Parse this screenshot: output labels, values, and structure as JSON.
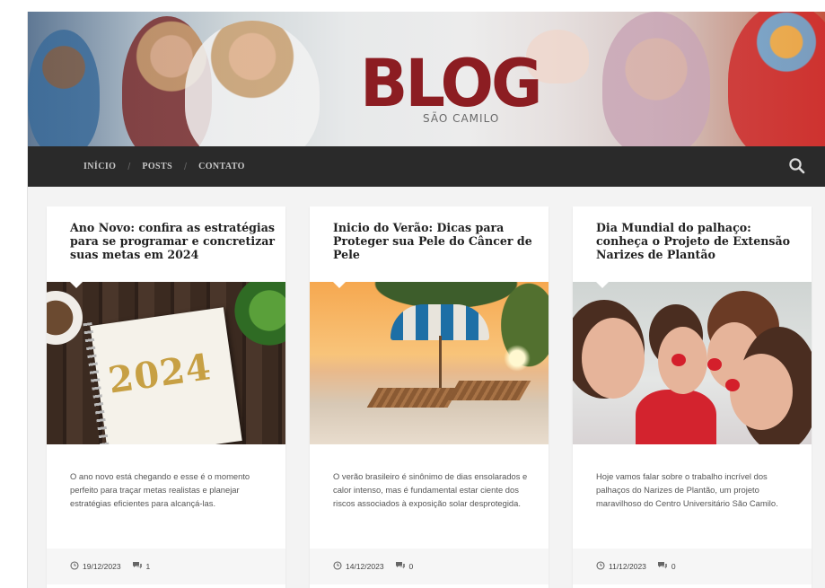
{
  "header": {
    "logo_main": "BLOG",
    "logo_sub": "SÃO CAMILO",
    "colors": {
      "logo": "#8c1d22",
      "nav_bg": "#2a2a2a"
    }
  },
  "nav": {
    "items": [
      {
        "label": "INÍCIO"
      },
      {
        "label": "POSTS"
      },
      {
        "label": "CONTATO"
      }
    ],
    "separator": "/",
    "search_icon": "search-icon"
  },
  "posts": [
    {
      "title": "Ano Novo: confira as estratégias para se programar e concretizar suas metas em 2024",
      "image_text": "2024",
      "excerpt": "O ano novo está chegando e esse é o momento perfeito para traçar metas realistas e planejar estratégias eficientes para alcançá-las.",
      "date": "19/12/2023",
      "comments": "1"
    },
    {
      "title": "Inicio do Verão: Dicas para Proteger sua Pele do Câncer de Pele",
      "excerpt": "O verão brasileiro é sinônimo de dias ensolarados e calor intenso, mas é fundamental estar ciente dos riscos associados à exposição solar desprotegida.",
      "date": "14/12/2023",
      "comments": "0"
    },
    {
      "title": "Dia Mundial do palhaço: conheça o Projeto de Extensão Narizes de Plantão",
      "excerpt": "Hoje vamos falar sobre o trabalho incrível dos palhaços do Narizes de Plantão, um projeto maravilhoso do Centro Universitário São Camilo.",
      "date": "11/12/2023",
      "comments": "0"
    }
  ],
  "icons": {
    "date": "clock-icon",
    "comments": "comment-icon"
  }
}
